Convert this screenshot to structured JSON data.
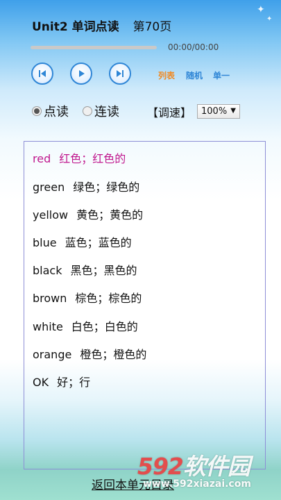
{
  "header": {
    "title": "Unit2 单词点读",
    "page": "第70页"
  },
  "player": {
    "time": "00:00/00:00",
    "progress": 0
  },
  "modes": {
    "list": "列表",
    "random": "随机",
    "single": "单一"
  },
  "mode_colors": {
    "list": "#f08a24",
    "random": "#2f86d6",
    "single": "#2f86d6"
  },
  "reading": {
    "option1": "点读",
    "option2": "连读",
    "selected": "option1"
  },
  "speed": {
    "label": "【调速】",
    "value": "100%"
  },
  "words": [
    {
      "en": "red",
      "zh": "红色；红色的",
      "active": true
    },
    {
      "en": "green",
      "zh": "绿色；绿色的"
    },
    {
      "en": "yellow",
      "zh": "黄色；黄色的"
    },
    {
      "en": "blue",
      "zh": "蓝色；蓝色的"
    },
    {
      "en": "black",
      "zh": "黑色；黑色的"
    },
    {
      "en": "brown",
      "zh": "棕色；棕色的"
    },
    {
      "en": "white",
      "zh": "白色；白色的"
    },
    {
      "en": "orange",
      "zh": "橙色；橙色的"
    },
    {
      "en": "OK",
      "zh": "好；行"
    }
  ],
  "footer": {
    "back": "返回本单元目录"
  },
  "watermark": {
    "num": "592",
    "text": "软件园",
    "url": "www.592xiazai.com"
  },
  "colors": {
    "active_word": "#c0188e",
    "accent": "#2f86d6"
  }
}
